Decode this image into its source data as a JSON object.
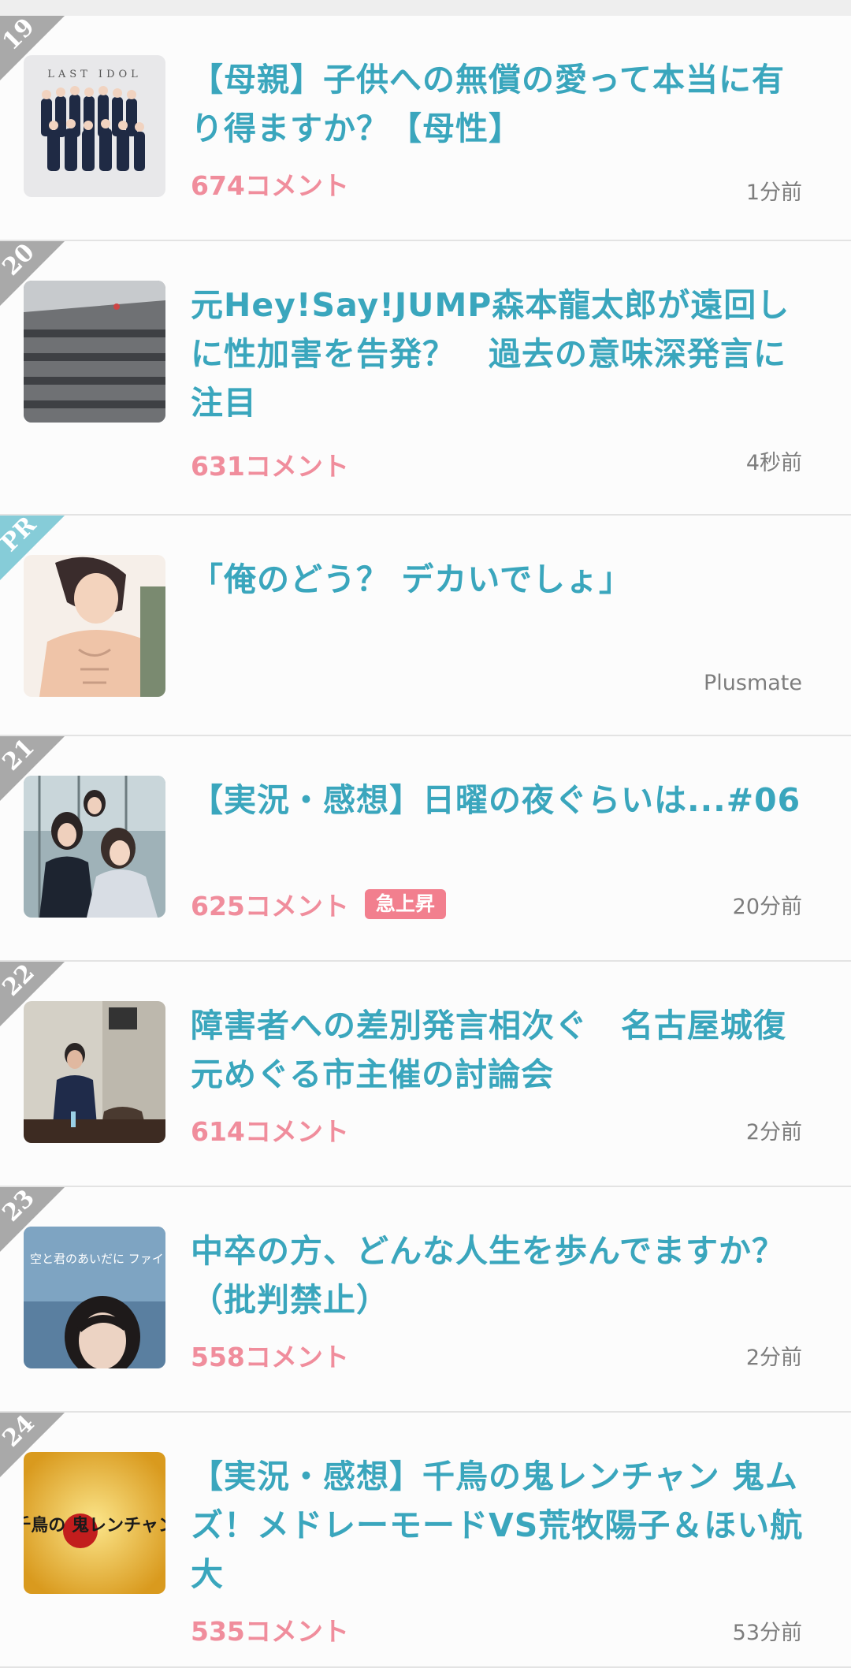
{
  "topics": [
    {
      "rank": "19",
      "title": "【母親】子供への無償の愛って本当に有り得ますか？【母性】",
      "comments": "674コメント",
      "badge": "",
      "time": "1分前",
      "thumbnail_icon": "idol-group-photo-icon",
      "thumbnail_caption": "LAST IDOL"
    },
    {
      "rank": "20",
      "title": "元Hey!Say!JUMP森本龍太郎が遠回しに性加害を告発？　過去の意味深発言に注目",
      "comments": "631コメント",
      "badge": "",
      "time": "4秒前",
      "thumbnail_icon": "office-building-icon",
      "thumbnail_caption": ""
    },
    {
      "rank": "PR",
      "title": "「俺のどう？ デカいでしょ」",
      "comments": "",
      "badge": "",
      "time": "Plusmate",
      "thumbnail_icon": "manga-illustration-icon",
      "thumbnail_caption": ""
    },
    {
      "rank": "21",
      "title": "【実況・感想】日曜の夜ぐらいは...#06",
      "comments": "625コメント",
      "badge": "急上昇",
      "time": "20分前",
      "thumbnail_icon": "drama-still-icon",
      "thumbnail_caption": ""
    },
    {
      "rank": "22",
      "title": "障害者への差別発言相次ぐ　名古屋城復元めぐる市主催の討論会",
      "comments": "614コメント",
      "badge": "",
      "time": "2分前",
      "thumbnail_icon": "meeting-speaker-icon",
      "thumbnail_caption": ""
    },
    {
      "rank": "23",
      "title": "中卒の方、どんな人生を歩んでますか？（批判禁止）",
      "comments": "558コメント",
      "badge": "",
      "time": "2分前",
      "thumbnail_icon": "book-cover-icon",
      "thumbnail_caption": "空と君のあいだに ファイト！"
    },
    {
      "rank": "24",
      "title": "【実況・感想】千鳥の鬼レンチャン 鬼ムズ！メドレーモードVS荒牧陽子＆ほい航大",
      "comments": "535コメント",
      "badge": "",
      "time": "53分前",
      "thumbnail_icon": "tv-show-logo-icon",
      "thumbnail_caption": "千鳥の 鬼レンチャン"
    }
  ]
}
